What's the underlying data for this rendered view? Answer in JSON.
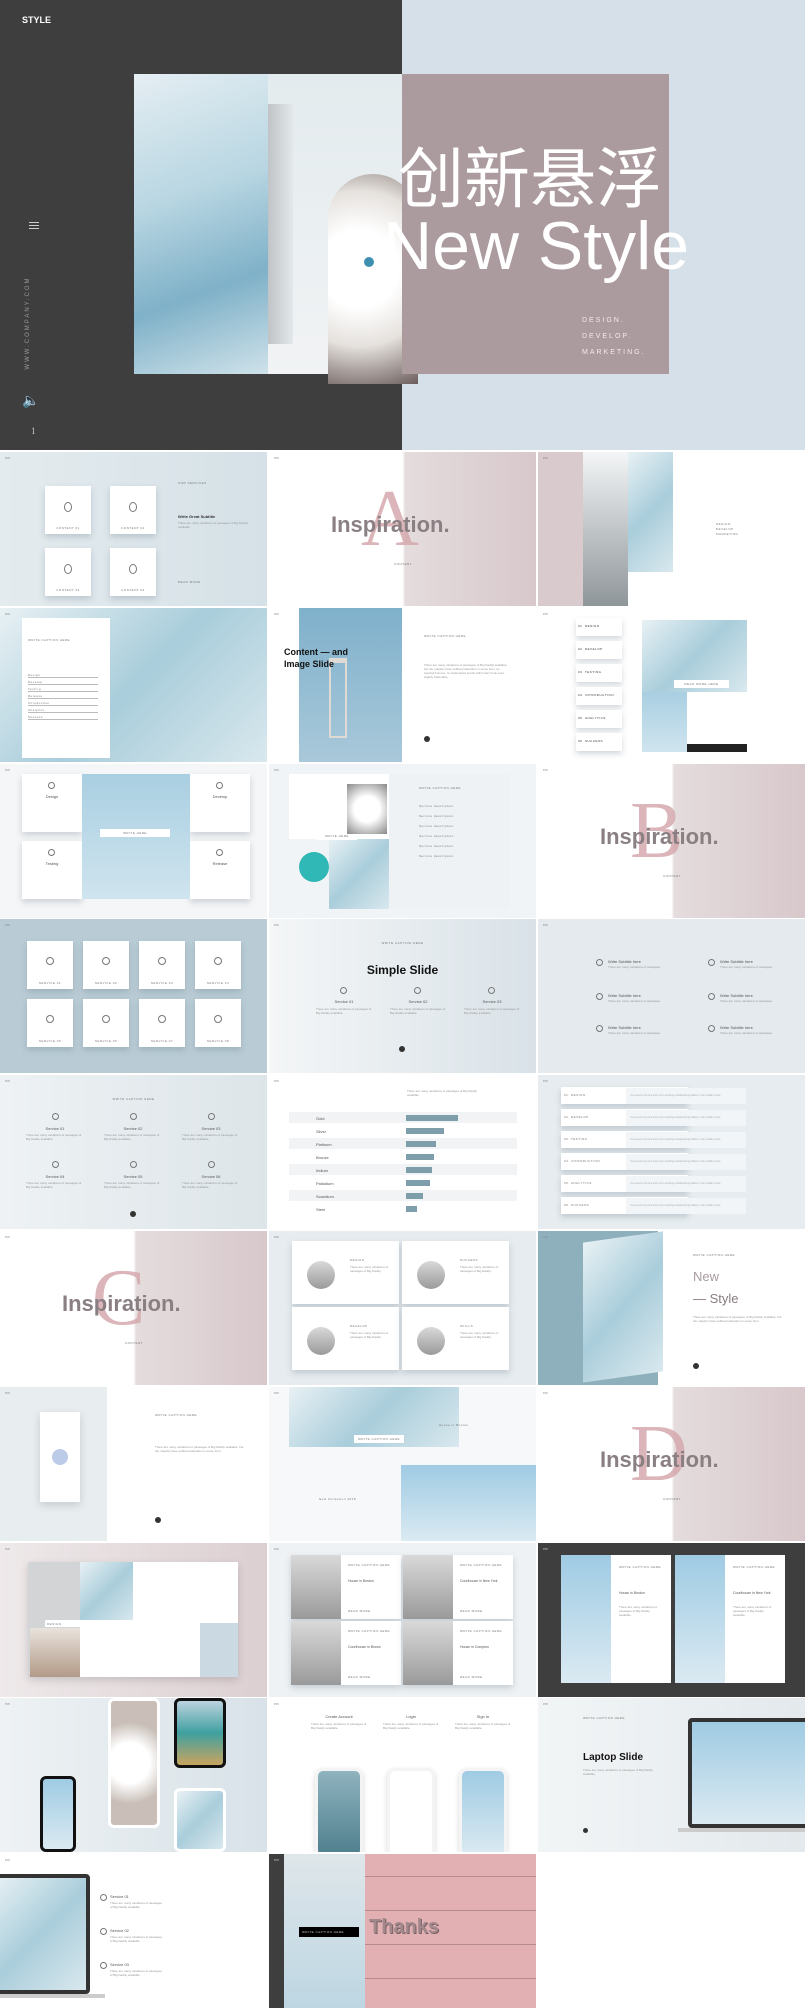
{
  "hero": {
    "brand": "STYLE",
    "title_cn": "创新悬浮",
    "title_en": "New Style",
    "taglines": [
      "DESIGN.",
      "DEVELOP.",
      "MARKETING."
    ],
    "website": "WWW.COMPANY.COM",
    "page_number": "1",
    "icons": [
      "menu-icon",
      "speaker-icon"
    ],
    "colors": {
      "dark": "#3e3e3e",
      "light": "#d6e0e8",
      "mauve": "#ab9a9e"
    }
  },
  "slides": [
    {
      "kind": "cards4",
      "bg": "#d5e1e7",
      "cards": [
        "CONTENT 01",
        "CONTENT 02",
        "CONTENT 03",
        "CONTENT 04"
      ],
      "label": "OUR SERVICES",
      "subtitle": "Write Great Subtitle",
      "body": "There are many variations of passages of Big Daddy available",
      "more": "READ MORE"
    },
    {
      "kind": "inspiration",
      "letter": "A",
      "title": "Inspiration.",
      "sub": "CONTENT"
    },
    {
      "kind": "strip",
      "items": [
        "DESIGN",
        "DEVELOP",
        "MARKETING"
      ]
    },
    {
      "kind": "ice",
      "label": "WRITE CAPTION HERE",
      "rows": [
        "Design",
        "Develop",
        "Testing",
        "Release",
        "Introduction",
        "Analytics",
        "Success"
      ]
    },
    {
      "kind": "content",
      "title": "Content — and Image Slide",
      "label": "WRITE CAPTION HERE",
      "body": "There are many variations of passages of Big Daddy available, but the majority have suffered alteration in some form, by injected humour, or randomised words which don't look even slightly believable."
    },
    {
      "kind": "list6",
      "items": [
        "01. DESIGN",
        "02. DEVELOP",
        "03. TESTING",
        "04. INTRODUCTION",
        "05. ANALYTICS",
        "06. SUCCESS"
      ],
      "caption": "READ MORE HERE"
    },
    {
      "kind": "quad",
      "items": [
        "Design",
        "Develop",
        "Testing",
        "Release"
      ],
      "caption": "WRITE HERE"
    },
    {
      "kind": "flowers",
      "label": "WRITE CAPTION HERE",
      "items": [
        "Service description",
        "Service description",
        "Service description",
        "Service description",
        "Service description",
        "Service description"
      ],
      "caption": "WRITE HERE"
    },
    {
      "kind": "inspiration",
      "letter": "B",
      "title": "Inspiration.",
      "sub": "CONTENT"
    },
    {
      "kind": "cards8",
      "cards": [
        "SERVICE 01",
        "SERVICE 02",
        "SERVICE 03",
        "SERVICE 04",
        "SERVICE 05",
        "SERVICE 06",
        "SERVICE 07",
        "SERVICE 08"
      ]
    },
    {
      "kind": "simple",
      "label": "WRITE CAPTION HERE",
      "title": "Simple Slide",
      "items": [
        "Service 01",
        "Service 02",
        "Service 03"
      ]
    },
    {
      "kind": "subtitles",
      "items": [
        "Write Subtitle here",
        "Write Subtitle here",
        "Write Subtitle here",
        "Write Subtitle here",
        "Write Subtitle here",
        "Write Subtitle here"
      ]
    },
    {
      "kind": "services6",
      "label": "WRITE CAPTION HERE",
      "items": [
        "Service 01",
        "Service 02",
        "Service 03",
        "Service 04",
        "Service 05",
        "Service 06"
      ]
    },
    {
      "kind": "bars",
      "intro": "There are many variations of passages of Big Daddy available",
      "chart_data": {
        "type": "bar",
        "orientation": "horizontal",
        "categories": [
          "Gold",
          "Silver",
          "Platinum",
          "Bronze",
          "Iridium",
          "Palladium",
          "Scandium",
          "Steel"
        ],
        "values": [
          100,
          74,
          57,
          54,
          50,
          46,
          33,
          21
        ],
        "color": "#7f9eab"
      }
    },
    {
      "kind": "rows6",
      "items": [
        "01. DESIGN",
        "02. DEVELOP",
        "03. TESTING",
        "04. INTRODUCTION",
        "05. ANALYTICS",
        "06. SUCCESS"
      ],
      "desc": "You need to be sure there isn't anything embarrassing hidden in the middle of text."
    },
    {
      "kind": "inspiration",
      "letter": "C",
      "title": "Inspiration.",
      "sub": "CONTENT"
    },
    {
      "kind": "people4",
      "items": [
        "DESIGN",
        "SUCCESS",
        "DEVELOP",
        "SKILLS"
      ]
    },
    {
      "kind": "newstyle",
      "label": "WRITE CAPTION HERE",
      "title1": "New",
      "title2": "— Style",
      "body": "There are many variations of passages of Big Daddy available, but the majority have suffered alteration in some form."
    },
    {
      "kind": "pendant",
      "label": "WRITE CAPTION HERE",
      "body": "There are many variations of passages of Big Daddy available, but the majority have suffered alteration in some form."
    },
    {
      "kind": "lights",
      "caption": "WRITE CAPTION HERE",
      "t1": "House in Boston",
      "t2": "New Collection 2018"
    },
    {
      "kind": "inspiration",
      "letter": "D",
      "title": "Inspiration.",
      "sub": "CONTENT"
    },
    {
      "kind": "collage",
      "label": "DESIGN"
    },
    {
      "kind": "people4b",
      "label": "WRITE CAPTION HERE",
      "items": [
        "House in Boston",
        "Courthouse in New York",
        "Courthouse in Brown",
        "House in Compton"
      ],
      "more": "READ MORE"
    },
    {
      "kind": "dark2",
      "label": "WRITE CAPTION HERE",
      "items": [
        "House in Boston",
        "Courthouse in New York"
      ]
    },
    {
      "kind": "phones"
    },
    {
      "kind": "phones3",
      "items": [
        "Create Account",
        "Login",
        "Sign In"
      ]
    },
    {
      "kind": "laptop",
      "label": "WRITE CAPTION HERE",
      "title": "Laptop Slide",
      "body": "There are many variations of passages of Big Daddy available."
    },
    {
      "kind": "laptop2",
      "items": [
        "Service 01",
        "Service 02",
        "Service 03"
      ]
    },
    {
      "kind": "thanks",
      "title": "Thanks",
      "caption": "WRITE CAPTION HERE"
    }
  ],
  "slide_mark": "PW"
}
